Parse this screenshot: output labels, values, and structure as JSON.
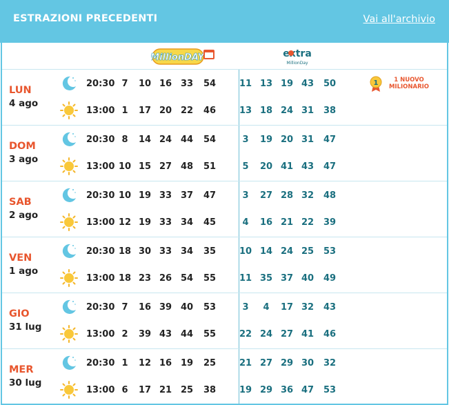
{
  "header": {
    "title": "ESTRAZIONI PRECEDENTI",
    "archive_link": "Vai all'archivio"
  },
  "logos": {
    "millionday": "MillionDAY",
    "extra": "extra",
    "extra_sub": "MillionDay"
  },
  "times": {
    "evening": "20:30",
    "midday": "13:00"
  },
  "badge": {
    "number": "1",
    "text": "1 NUOVO MILIONARIO"
  },
  "days": [
    {
      "name": "LUN",
      "date": "4 ago",
      "evening": {
        "main": [
          "7",
          "10",
          "16",
          "33",
          "54"
        ],
        "extra": [
          "11",
          "13",
          "19",
          "43",
          "50"
        ]
      },
      "midday": {
        "main": [
          "1",
          "17",
          "20",
          "22",
          "46"
        ],
        "extra": [
          "13",
          "18",
          "24",
          "31",
          "38"
        ]
      }
    },
    {
      "name": "DOM",
      "date": "3 ago",
      "evening": {
        "main": [
          "8",
          "14",
          "24",
          "44",
          "54"
        ],
        "extra": [
          "3",
          "19",
          "20",
          "31",
          "47"
        ]
      },
      "midday": {
        "main": [
          "10",
          "15",
          "27",
          "48",
          "51"
        ],
        "extra": [
          "5",
          "20",
          "41",
          "43",
          "47"
        ]
      }
    },
    {
      "name": "SAB",
      "date": "2 ago",
      "evening": {
        "main": [
          "10",
          "19",
          "33",
          "37",
          "47"
        ],
        "extra": [
          "3",
          "27",
          "28",
          "32",
          "48"
        ]
      },
      "midday": {
        "main": [
          "12",
          "19",
          "33",
          "34",
          "45"
        ],
        "extra": [
          "4",
          "16",
          "21",
          "22",
          "39"
        ]
      }
    },
    {
      "name": "VEN",
      "date": "1 ago",
      "evening": {
        "main": [
          "18",
          "30",
          "33",
          "34",
          "35"
        ],
        "extra": [
          "10",
          "14",
          "24",
          "25",
          "53"
        ]
      },
      "midday": {
        "main": [
          "18",
          "23",
          "26",
          "54",
          "55"
        ],
        "extra": [
          "11",
          "35",
          "37",
          "40",
          "49"
        ]
      }
    },
    {
      "name": "GIO",
      "date": "31 lug",
      "evening": {
        "main": [
          "7",
          "16",
          "39",
          "40",
          "53"
        ],
        "extra": [
          "3",
          "4",
          "17",
          "32",
          "43"
        ]
      },
      "midday": {
        "main": [
          "2",
          "39",
          "43",
          "44",
          "55"
        ],
        "extra": [
          "22",
          "24",
          "27",
          "41",
          "46"
        ]
      }
    },
    {
      "name": "MER",
      "date": "30 lug",
      "evening": {
        "main": [
          "1",
          "12",
          "16",
          "19",
          "25"
        ],
        "extra": [
          "21",
          "27",
          "29",
          "30",
          "32"
        ]
      },
      "midday": {
        "main": [
          "6",
          "17",
          "21",
          "25",
          "38"
        ],
        "extra": [
          "19",
          "29",
          "36",
          "47",
          "53"
        ]
      }
    }
  ]
}
